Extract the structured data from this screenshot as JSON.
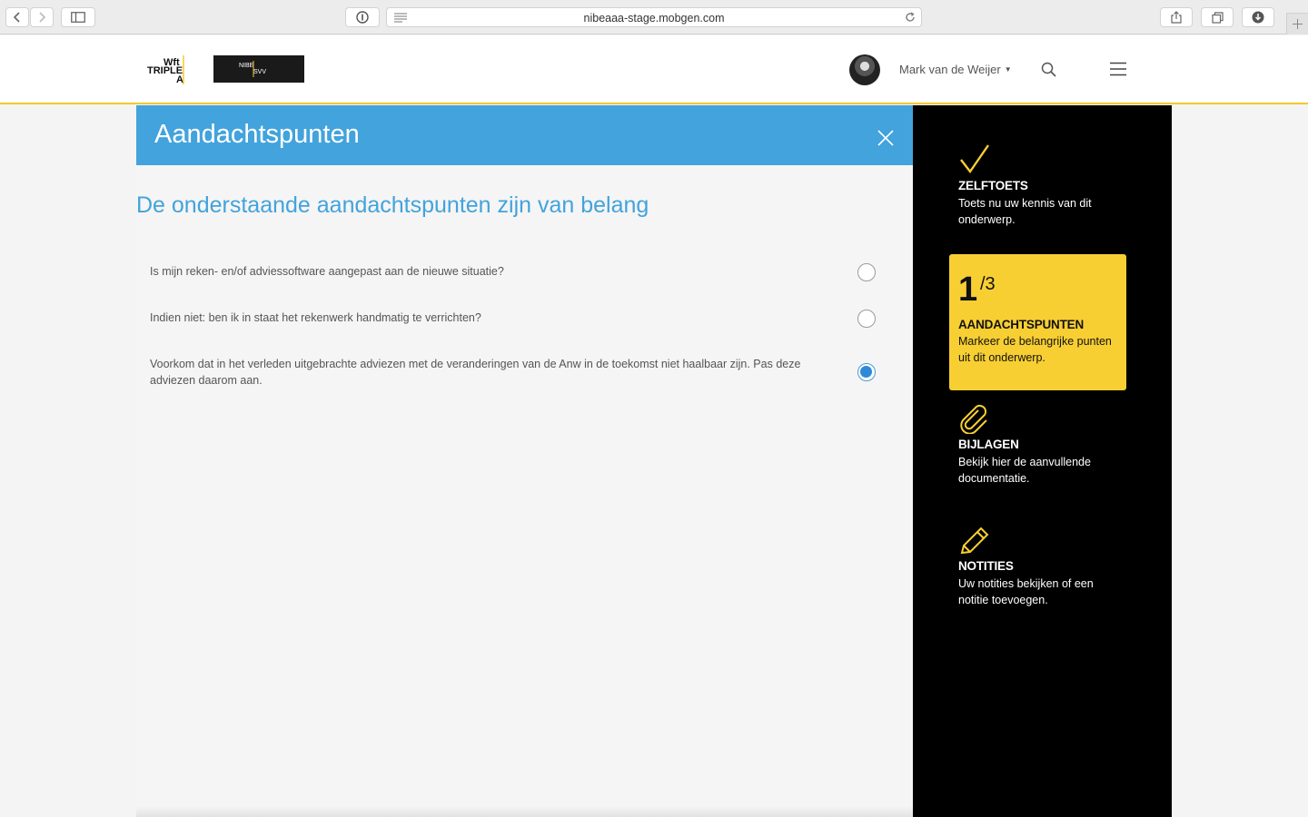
{
  "browser": {
    "url": "nibeaaa-stage.mobgen.com"
  },
  "header": {
    "logo_wft": [
      "Wft",
      "TRIPLE",
      "A"
    ],
    "logo_nibe": [
      "NIBE",
      "SVV"
    ],
    "user_name": "Mark van de Weijer"
  },
  "panel": {
    "title": "Aandachtspunten",
    "subtitle": "De onderstaande aandachtspunten zijn van belang",
    "items": [
      {
        "text": "Is mijn reken- en/of adviessoftware aangepast aan de nieuwe situatie?",
        "checked": false
      },
      {
        "text": "Indien niet: ben ik in staat het rekenwerk handmatig te verrichten?",
        "checked": false
      },
      {
        "text": "Voorkom dat in het verleden uitgebrachte adviezen met de veranderingen van de Anw in de toekomst niet haalbaar zijn. Pas deze adviezen daarom aan.",
        "checked": true
      }
    ]
  },
  "sidebar": {
    "zelftoets": {
      "title": "ZELFTOETS",
      "desc": "Toets nu uw kennis van dit onderwerp.",
      "icon": "checkmark-icon"
    },
    "aandachtspunten": {
      "current": "1",
      "total": "/3",
      "title": "AANDACHTSPUNTEN",
      "desc": "Markeer de belangrijke punten uit dit onderwerp."
    },
    "bijlagen": {
      "title": "BIJLAGEN",
      "desc": "Bekijk hier de aanvullende documentatie.",
      "icon": "paperclip-icon"
    },
    "notities": {
      "title": "NOTITIES",
      "desc": "Uw notities bekijken of een notitie toevoegen.",
      "icon": "pencil-icon"
    }
  },
  "colors": {
    "accent_blue": "#42a3dd",
    "accent_yellow": "#f8cf33",
    "sidebar_bg": "#000000"
  }
}
